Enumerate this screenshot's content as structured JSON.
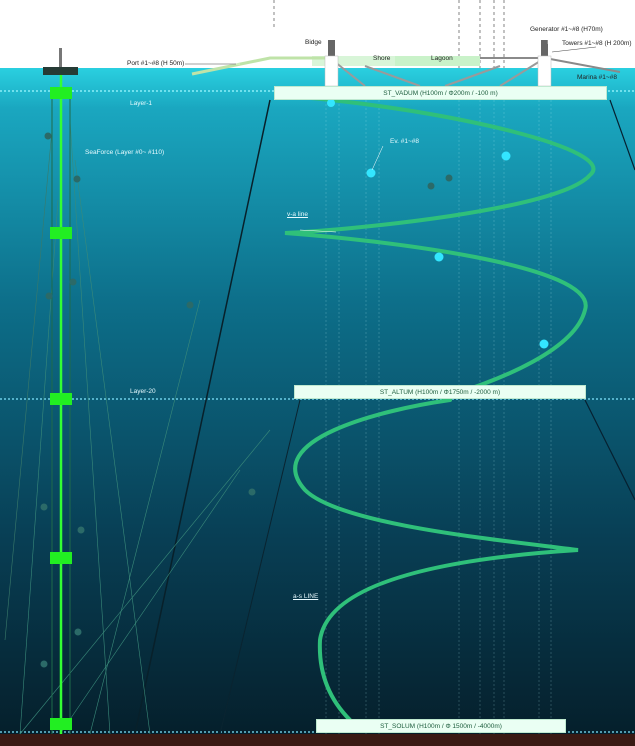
{
  "labels": {
    "bridge": "Bidge",
    "shore": "Shore",
    "lagoon": "Lagoon",
    "generator": "Generator #1~#8 (H70m)",
    "towers": "Towers #1~#8 (H 200m)",
    "port": "Port #1~#8 (H 50m)",
    "marina": "Marina #1~#8",
    "layer1": "Layer-1",
    "layer20": "Layer-20",
    "seaforce": "SeaForce (Layer #0~ #110)",
    "ev": "Ev. #1~#8",
    "va_line": "v-a line",
    "as_line": "a-s LINE"
  },
  "stations": {
    "vadum": "ST_VADUM (H100m / Φ200m / -100 m)",
    "altum": "ST_ALTUM (H100m / Φ1750m / -2000 m)",
    "solum": "ST_SOLUM (H100m / Φ 1500m / -4000m)"
  },
  "colors": {
    "sky": "#ffffff",
    "sea_top": "#2ad0e0",
    "sea_mid": "#0b5f7a",
    "sea_deep": "#062a38",
    "seabed": "#3a1a14",
    "spiral": "#2fc07a",
    "column": "#33ff33",
    "node": "#22ee22",
    "cyan_dot": "#33e6ff",
    "layer_line": "#7ff0ff",
    "banner_bg": "#eafff3"
  }
}
